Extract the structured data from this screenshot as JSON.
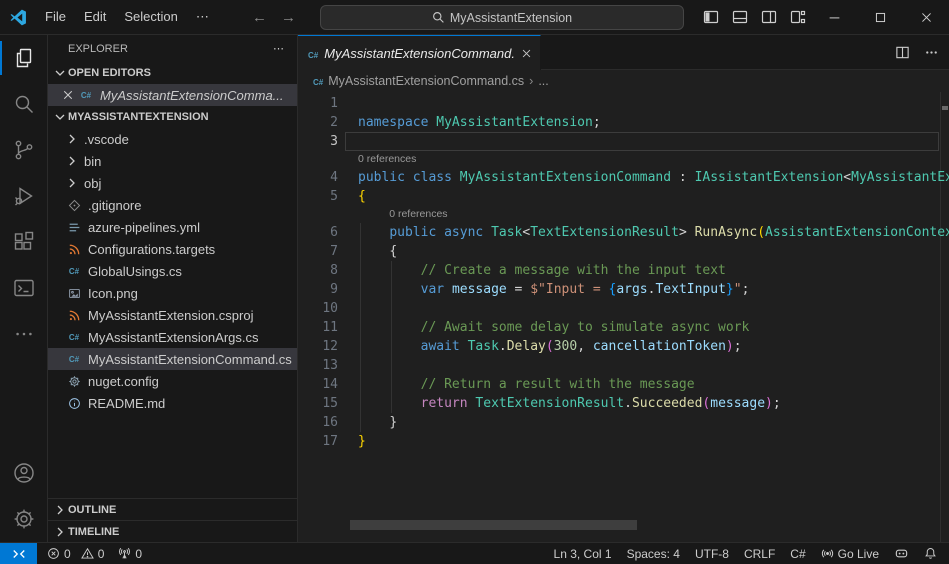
{
  "colors": {
    "accent": "#0078d4",
    "titlebar_bg": "#181818",
    "editor_bg": "#1f1f1f",
    "selection_bg": "#37373d",
    "csharp_icon": "#519aba",
    "xml_icon": "#e37933"
  },
  "titlebar": {
    "menu": [
      "File",
      "Edit",
      "Selection",
      "⋯"
    ],
    "search_text": "MyAssistantExtension"
  },
  "activity_bar": {
    "top": [
      {
        "name": "explorer",
        "icon": "files",
        "active": true
      },
      {
        "name": "search",
        "icon": "search",
        "active": false
      },
      {
        "name": "source-control",
        "icon": "scm",
        "active": false
      },
      {
        "name": "run-debug",
        "icon": "debug",
        "active": false
      },
      {
        "name": "extensions",
        "icon": "ext",
        "active": false
      },
      {
        "name": "terminal",
        "icon": "terminal",
        "active": false
      },
      {
        "name": "more",
        "icon": "moredots",
        "active": false
      }
    ],
    "bottom": [
      {
        "name": "accounts",
        "icon": "account",
        "active": false
      },
      {
        "name": "settings",
        "icon": "gear",
        "active": false
      }
    ]
  },
  "sidebar": {
    "title": "EXPLORER",
    "more": "⋯",
    "open_editors": {
      "label": "OPEN EDITORS",
      "items": [
        {
          "name": "MyAssistantExtensionComma...",
          "icon": "csharp",
          "selected": true
        }
      ]
    },
    "project": {
      "label": "MYASSISTANTEXTENSION",
      "items": [
        {
          "name": ".vscode",
          "type": "folder"
        },
        {
          "name": "bin",
          "type": "folder"
        },
        {
          "name": "obj",
          "type": "folder"
        },
        {
          "name": ".gitignore",
          "icon": "git",
          "color": "#8c8c8c"
        },
        {
          "name": "azure-pipelines.yml",
          "icon": "lines",
          "color": "#7a99ac"
        },
        {
          "name": "Configurations.targets",
          "icon": "rss",
          "color": "#e37933"
        },
        {
          "name": "GlobalUsings.cs",
          "icon": "csharp",
          "color": "#519aba"
        },
        {
          "name": "Icon.png",
          "icon": "image",
          "color": "#8f9bab"
        },
        {
          "name": "MyAssistantExtension.csproj",
          "icon": "rss",
          "color": "#e37933"
        },
        {
          "name": "MyAssistantExtensionArgs.cs",
          "icon": "csharp",
          "color": "#519aba"
        },
        {
          "name": "MyAssistantExtensionCommand.cs",
          "icon": "csharp",
          "color": "#519aba",
          "selected": true
        },
        {
          "name": "nuget.config",
          "icon": "gearfile",
          "color": "#8ca1b0"
        },
        {
          "name": "README.md",
          "icon": "info",
          "color": "#9fc6e8"
        }
      ]
    },
    "outline_label": "OUTLINE",
    "timeline_label": "TIMELINE"
  },
  "editor": {
    "tab": {
      "label": "MyAssistantExtensionCommand.cs",
      "icon": "csharp"
    },
    "breadcrumb": {
      "file": "MyAssistantExtensionCommand.cs",
      "tail": "..."
    },
    "codelens_text": "0 references",
    "lines": [
      {
        "n": 1,
        "t": []
      },
      {
        "n": 2,
        "t": [
          [
            "kw",
            "namespace"
          ],
          [
            "pl",
            " "
          ],
          [
            "ty",
            "MyAssistantExtension"
          ],
          [
            "pl",
            ";"
          ]
        ]
      },
      {
        "n": 3,
        "t": [],
        "current": true
      },
      {
        "lens": true,
        "indent": 0
      },
      {
        "n": 4,
        "t": [
          [
            "kw",
            "public"
          ],
          [
            "pl",
            " "
          ],
          [
            "kw",
            "class"
          ],
          [
            "pl",
            " "
          ],
          [
            "ty",
            "MyAssistantExtensionCommand"
          ],
          [
            "pl",
            " : "
          ],
          [
            "ty",
            "IAssistantExtension"
          ],
          [
            "pl",
            "<"
          ],
          [
            "ty",
            "MyAssistantExtensionArgs"
          ]
        ]
      },
      {
        "n": 5,
        "t": [
          [
            "b1",
            "{"
          ]
        ]
      },
      {
        "lens": true,
        "indent": 4
      },
      {
        "n": 6,
        "t": [
          [
            "pl",
            "    "
          ],
          [
            "kw",
            "public"
          ],
          [
            "pl",
            " "
          ],
          [
            "kw",
            "async"
          ],
          [
            "pl",
            " "
          ],
          [
            "ty",
            "Task"
          ],
          [
            "pl",
            "<"
          ],
          [
            "ty",
            "TextExtensionResult"
          ],
          [
            "pl",
            "> "
          ],
          [
            "fn",
            "RunAsync"
          ],
          [
            "b1",
            "("
          ],
          [
            "ty",
            "AssistantExtensionContext"
          ]
        ]
      },
      {
        "n": 7,
        "t": [
          [
            "pl",
            "    "
          ],
          [
            "pw",
            "{"
          ]
        ]
      },
      {
        "n": 8,
        "t": [
          [
            "pl",
            "        "
          ],
          [
            "cm",
            "// Create a message with the input text"
          ]
        ]
      },
      {
        "n": 9,
        "t": [
          [
            "pl",
            "        "
          ],
          [
            "kw",
            "var"
          ],
          [
            "pl",
            " "
          ],
          [
            "vr",
            "message"
          ],
          [
            "pl",
            " = "
          ],
          [
            "st",
            "$\"Input = "
          ],
          [
            "b3",
            "{"
          ],
          [
            "vr",
            "args"
          ],
          [
            "pl",
            "."
          ],
          [
            "vr",
            "TextInput"
          ],
          [
            "b3",
            "}"
          ],
          [
            "st",
            "\""
          ],
          [
            "pl",
            ";"
          ]
        ]
      },
      {
        "n": 10,
        "t": []
      },
      {
        "n": 11,
        "t": [
          [
            "pl",
            "        "
          ],
          [
            "cm",
            "// Await some delay to simulate async work"
          ]
        ]
      },
      {
        "n": 12,
        "t": [
          [
            "pl",
            "        "
          ],
          [
            "kw",
            "await"
          ],
          [
            "pl",
            " "
          ],
          [
            "ty",
            "Task"
          ],
          [
            "pl",
            "."
          ],
          [
            "fn",
            "Delay"
          ],
          [
            "b2",
            "("
          ],
          [
            "nu",
            "300"
          ],
          [
            "pl",
            ", "
          ],
          [
            "vr",
            "cancellationToken"
          ],
          [
            "b2",
            ")"
          ],
          [
            "pl",
            ";"
          ]
        ]
      },
      {
        "n": 13,
        "t": []
      },
      {
        "n": 14,
        "t": [
          [
            "pl",
            "        "
          ],
          [
            "cm",
            "// Return a result with the message"
          ]
        ]
      },
      {
        "n": 15,
        "t": [
          [
            "pl",
            "        "
          ],
          [
            "ct",
            "return"
          ],
          [
            "pl",
            " "
          ],
          [
            "ty",
            "TextExtensionResult"
          ],
          [
            "pl",
            "."
          ],
          [
            "fn",
            "Succeeded"
          ],
          [
            "b2",
            "("
          ],
          [
            "vr",
            "message"
          ],
          [
            "b2",
            ")"
          ],
          [
            "pl",
            ";"
          ]
        ]
      },
      {
        "n": 16,
        "t": [
          [
            "pl",
            "    "
          ],
          [
            "pw",
            "}"
          ]
        ]
      },
      {
        "n": 17,
        "t": [
          [
            "b1",
            "}"
          ]
        ]
      }
    ]
  },
  "status_bar": {
    "errors": "0",
    "warnings": "0",
    "ports": "0",
    "line_col": "Ln 3, Col 1",
    "indentation": "Spaces: 4",
    "encoding": "UTF-8",
    "eol": "CRLF",
    "language": "C#",
    "go_live": "Go Live"
  }
}
